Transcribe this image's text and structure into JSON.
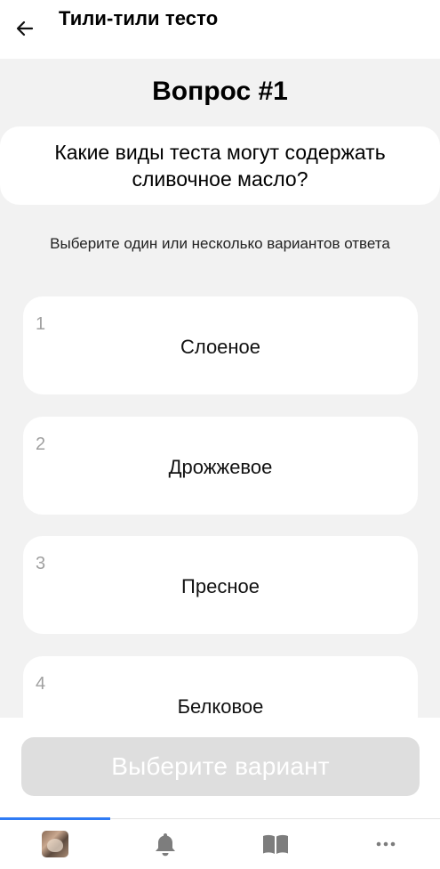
{
  "header": {
    "title": "Тили-тили тесто"
  },
  "question": {
    "title": "Вопрос #1",
    "text": "Какие виды теста могут содержать сливочное масло?",
    "hint": "Выберите один или несколько вариантов ответа"
  },
  "options": [
    {
      "number": "1",
      "label": "Слоеное"
    },
    {
      "number": "2",
      "label": "Дрожжевое"
    },
    {
      "number": "3",
      "label": "Пресное"
    },
    {
      "number": "4",
      "label": "Белковое"
    }
  ],
  "submit": {
    "label": "Выберите вариант"
  },
  "tabbar": {
    "tabs": [
      {
        "icon": "avatar"
      },
      {
        "icon": "bell-icon"
      },
      {
        "icon": "book-icon"
      },
      {
        "icon": "more-icon"
      }
    ],
    "active_color": "#2f7bf5"
  }
}
